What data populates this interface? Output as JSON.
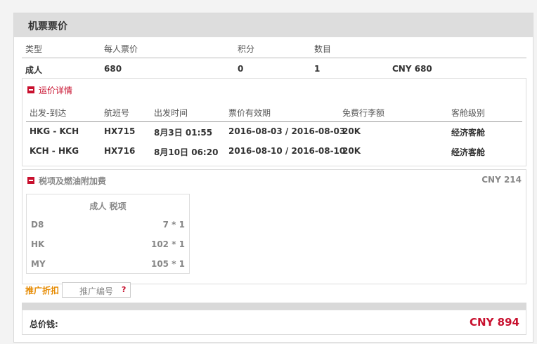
{
  "header": {
    "title": "机票票价"
  },
  "price_table": {
    "columns": [
      "类型",
      "每人票价",
      "积分",
      "数目"
    ],
    "row": {
      "type": "成人",
      "price": "680",
      "points": "0",
      "count": "1",
      "total": "CNY 680"
    }
  },
  "fare_details": {
    "title": "运价详情",
    "columns": [
      "出发-到达",
      "航班号",
      "出发时间",
      "票价有效期",
      "免费行李额",
      "客舱级别"
    ],
    "rows": [
      {
        "route": "HKG - KCH",
        "flight": "HX715",
        "time": "8月3日 01:55",
        "validity": "2016-08-03 / 2016-08-03",
        "baggage": "20K",
        "cabin": "经济客舱"
      },
      {
        "route": "KCH - HKG",
        "flight": "HX716",
        "time": "8月10日 06:20",
        "validity": "2016-08-10 / 2016-08-10",
        "baggage": "20K",
        "cabin": "经济客舱"
      }
    ]
  },
  "taxes": {
    "title": "税项及燃油附加费",
    "total": "CNY 214",
    "table_title": "成人 税项",
    "rows": [
      {
        "code": "D8",
        "value": "7 * 1"
      },
      {
        "code": "HK",
        "value": "102 * 1"
      },
      {
        "code": "MY",
        "value": "105 * 1"
      }
    ]
  },
  "promo": {
    "label": "推广折扣",
    "placeholder": "推广编号",
    "help": "?"
  },
  "total": {
    "label": "总价钱:",
    "value": "CNY 894"
  },
  "icons": {
    "expand": "minus-square-icon",
    "help": "question-icon"
  },
  "colors": {
    "accent": "#c8102e",
    "promo": "#e68a00",
    "header_bg": "#dddddd"
  }
}
